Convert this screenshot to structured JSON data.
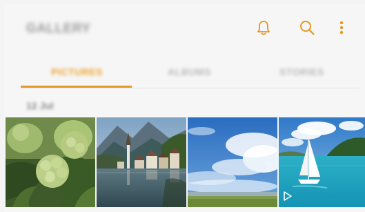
{
  "header": {
    "title": "GALLERY",
    "icons": [
      "bell-icon",
      "search-icon",
      "more-vert-icon"
    ],
    "accent_color": "#e6971f"
  },
  "tabs": [
    {
      "label": "PICTURES",
      "active": true
    },
    {
      "label": "ALBUMS",
      "active": false
    },
    {
      "label": "STORIES",
      "active": false
    }
  ],
  "section": {
    "date_label": "12 Jul"
  },
  "photos": [
    {
      "subject": "green hydrangea flowers"
    },
    {
      "subject": "lakeside alpine village"
    },
    {
      "subject": "blue sky with clouds"
    },
    {
      "subject": "sailboat on turquoise sea",
      "is_video": true
    }
  ]
}
